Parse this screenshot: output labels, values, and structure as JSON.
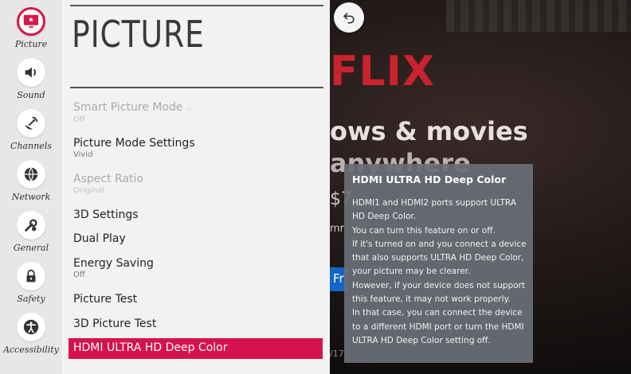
{
  "background": {
    "logo_fragment": "FLIX",
    "headline_1": "ows & movies",
    "headline_2": "anywhere",
    "fragment_1": "$7",
    "fragment_2": "mr",
    "button_fragment": "Fr",
    "footer_fragment": "/17"
  },
  "sidebar": {
    "items": [
      {
        "label": "Picture",
        "icon": "picture-icon"
      },
      {
        "label": "Sound",
        "icon": "sound-icon"
      },
      {
        "label": "Channels",
        "icon": "channels-icon"
      },
      {
        "label": "Network",
        "icon": "network-icon"
      },
      {
        "label": "General",
        "icon": "general-icon"
      },
      {
        "label": "Safety",
        "icon": "lock-icon"
      },
      {
        "label": "Accessibility",
        "icon": "accessibility-icon"
      }
    ],
    "active": "Picture"
  },
  "panel": {
    "title": "PICTURE",
    "items": [
      {
        "label": "Smart Picture Mode",
        "value": "Off",
        "state": "disabled",
        "has_chevron": true
      },
      {
        "label": "Picture Mode Settings",
        "value": "Vivid",
        "state": "enabled"
      },
      {
        "label": "Aspect Ratio",
        "value": "Original",
        "state": "disabled"
      },
      {
        "label": "3D Settings",
        "value": "",
        "state": "enabled"
      },
      {
        "label": "Dual Play",
        "value": "",
        "state": "enabled"
      },
      {
        "label": "Energy Saving",
        "value": "Off",
        "state": "enabled"
      },
      {
        "label": "Picture Test",
        "value": "",
        "state": "enabled"
      },
      {
        "label": "3D Picture Test",
        "value": "",
        "state": "enabled"
      },
      {
        "label": "HDMI ULTRA HD Deep Color",
        "value": "",
        "state": "selected"
      }
    ]
  },
  "help": {
    "title": "HDMI ULTRA HD Deep Color",
    "lines": [
      "HDMI1 and HDMI2 ports support ULTRA",
      "HD Deep Color.",
      "You can turn this feature on or off.",
      "If it's turned on and you connect a device",
      "that also supports ULTRA HD Deep Color,",
      "your picture may be clearer.",
      "However, if your device does not support",
      "this feature, it may not work properly.",
      "In that case, you can connect the device",
      "to a different HDMI port or turn the HDMI",
      "ULTRA HD Deep Color setting off."
    ]
  },
  "colors": {
    "accent": "#d6114f",
    "sidebar_bg": "#e7e7e7",
    "panel_bg": "#f2f2f2",
    "help_bg": "#696e76"
  }
}
